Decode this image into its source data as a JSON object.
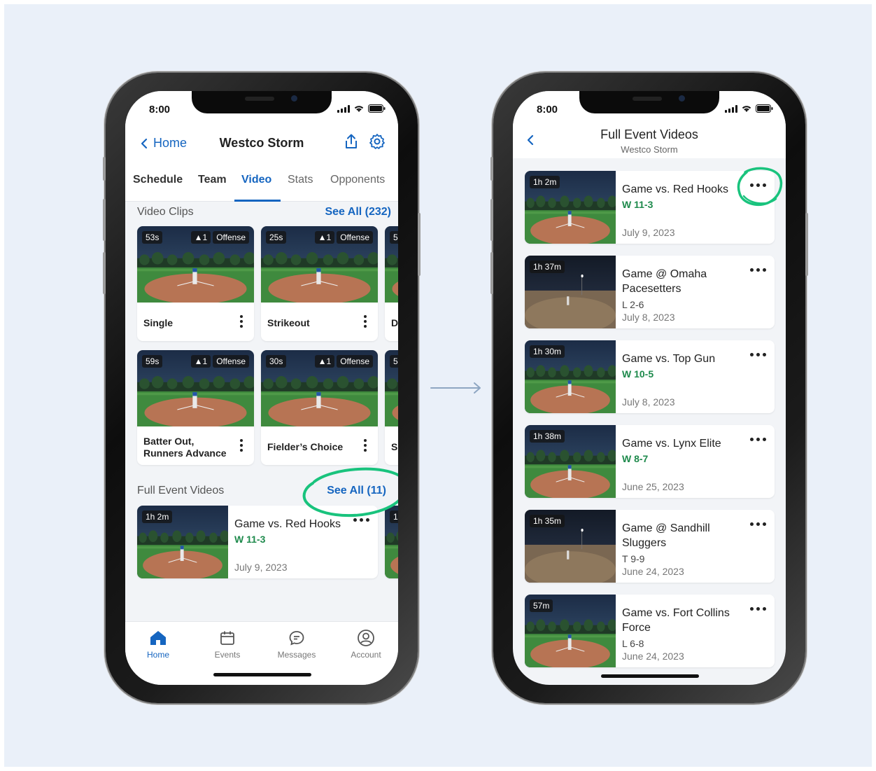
{
  "left": {
    "status": {
      "time": "8:00"
    },
    "header": {
      "back_label": "Home",
      "title": "Westco Storm"
    },
    "tabs": [
      {
        "label": "Schedule",
        "active": false
      },
      {
        "label": "Team",
        "active": false
      },
      {
        "label": "Video",
        "active": true
      },
      {
        "label": "Stats",
        "active": false
      },
      {
        "label": "Opponents",
        "active": false
      }
    ],
    "clips_section": {
      "title": "Video Clips",
      "see_all": "See All (232)"
    },
    "clips": [
      {
        "duration": "53s",
        "count": "▲1",
        "tag": "Offense",
        "label": "Single"
      },
      {
        "duration": "25s",
        "count": "▲1",
        "tag": "Offense",
        "label": "Strikeout"
      },
      {
        "duration": "5",
        "label": "D"
      },
      {
        "duration": "59s",
        "count": "▲1",
        "tag": "Offense",
        "label": "Batter Out,\nRunners Advance"
      },
      {
        "duration": "30s",
        "count": "▲1",
        "tag": "Offense",
        "label": "Fielder’s Choice"
      },
      {
        "duration": "5",
        "label": "Si"
      }
    ],
    "events_section": {
      "title": "Full Event Videos",
      "see_all": "See All (11)"
    },
    "event": {
      "duration": "1h 2m",
      "title": "Game vs. Red Hooks",
      "result": "W 11-3",
      "date": "July 9, 2023"
    },
    "event_peek": {
      "duration": "1"
    },
    "tabbar": [
      {
        "label": "Home",
        "icon": "home-icon",
        "active": true
      },
      {
        "label": "Events",
        "icon": "calendar-icon",
        "active": false
      },
      {
        "label": "Messages",
        "icon": "chat-icon",
        "active": false
      },
      {
        "label": "Account",
        "icon": "account-icon",
        "active": false
      }
    ]
  },
  "right": {
    "status": {
      "time": "8:00"
    },
    "header": {
      "title": "Full Event Videos",
      "subtitle": "Westco Storm"
    },
    "events": [
      {
        "duration": "1h 2m",
        "title": "Game vs. Red Hooks",
        "result": "W 11-3",
        "date": "July 9, 2023"
      },
      {
        "duration": "1h 37m",
        "title": "Game @ Omaha\nPacesetters",
        "result": "L 2-6",
        "date": "July 8, 2023"
      },
      {
        "duration": "1h 30m",
        "title": "Game vs. Top Gun",
        "result": "W 10-5",
        "date": "July 8, 2023"
      },
      {
        "duration": "1h 38m",
        "title": "Game vs. Lynx Elite",
        "result": "W 8-7",
        "date": "June 25, 2023"
      },
      {
        "duration": "1h 35m",
        "title": "Game @ Sandhill\nSluggers",
        "result": "T 9-9",
        "date": "June 24, 2023"
      },
      {
        "duration": "57m",
        "title": "Game vs. Fort Collins\nForce",
        "result": "L 6-8",
        "date": "June 24, 2023"
      }
    ]
  },
  "colors": {
    "accent": "#1565c0",
    "win": "#1e8a4c",
    "highlight": "#19c37d"
  }
}
